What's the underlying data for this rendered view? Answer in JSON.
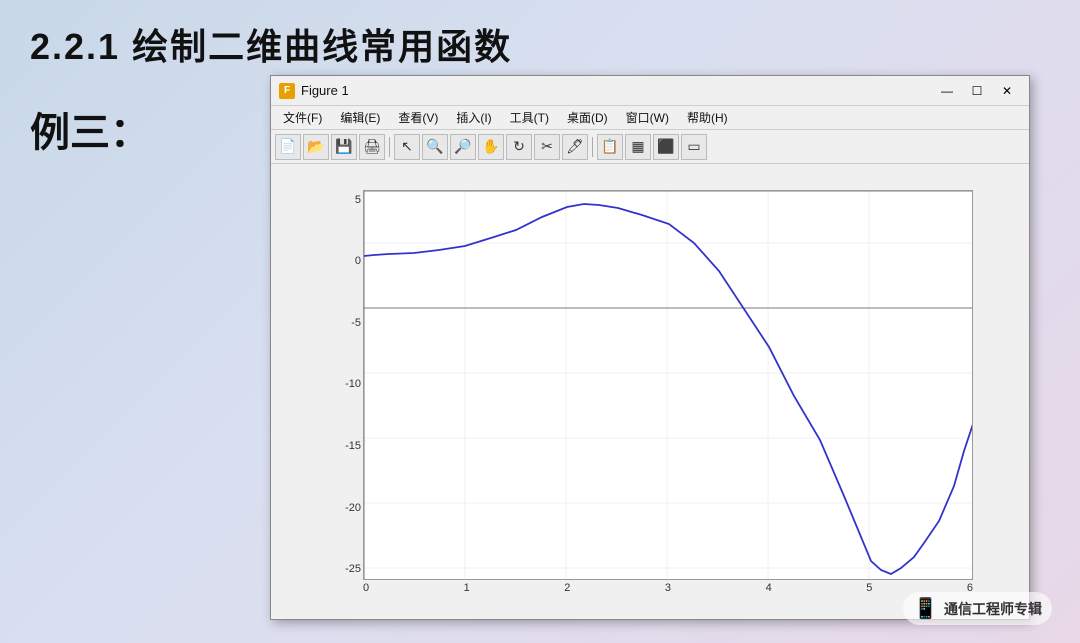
{
  "page": {
    "title": "2.2.1  绘制二维曲线常用函数",
    "example_label": "例三："
  },
  "figure_window": {
    "title": "Figure 1",
    "menu_items": [
      "文件(F)",
      "编辑(E)",
      "查看(V)",
      "插入(I)",
      "工具(T)",
      "桌面(D)",
      "窗口(W)",
      "帮助(H)"
    ],
    "toolbar_icons": [
      "📄",
      "📂",
      "💾",
      "🖨",
      "↖",
      "🔍",
      "🔍",
      "✋",
      "↻",
      "✂",
      "🖊",
      "📋",
      "📊",
      "⬛",
      "▭"
    ],
    "win_controls": [
      "—",
      "□",
      "✕"
    ]
  },
  "chart": {
    "y_axis_labels": [
      "5",
      "0",
      "-5",
      "-10",
      "-15",
      "-20",
      "-25"
    ],
    "x_axis_labels": [
      "0",
      "1",
      "2",
      "3",
      "4",
      "5",
      "6"
    ]
  },
  "watermark": {
    "icon": "📱",
    "text": "通信工程师专辑"
  }
}
